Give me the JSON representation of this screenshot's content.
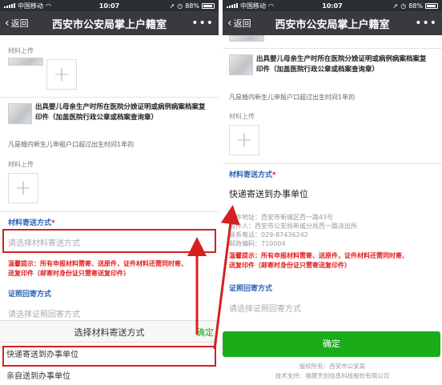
{
  "status": {
    "carrier": "中国移动",
    "time": "10:07",
    "battery": "88%"
  },
  "nav": {
    "back_label": "返回",
    "title": "西安市公安局掌上户籍室",
    "more": "•••"
  },
  "left": {
    "upload_label_1": "材料上传",
    "doc_title_line1": "出具婴儿母亲生产时所在医院分娩证明或病例病案档案复",
    "doc_title_line2": "印件（加盖医院行政公章或档案查询章）",
    "note": "凡是婚内新生儿申报户口超过出生时间1年的",
    "upload_label_2": "材料上传",
    "delivery_title": "材料寄送方式",
    "req_mark": "*",
    "delivery_placeholder": "请选择材料寄送方式",
    "warn_line1": "温馨提示：所有申报材料需寄、送原件，证件材料还需同时寄、",
    "warn_line2": "送复印件（邮寄时身份证只需寄送复印件）",
    "return_title": "证照回寄方式",
    "return_placeholder": "请选择证照回寄方式",
    "picker_title": "选择材料寄送方式",
    "picker_confirm": "确定",
    "option_1": "快递寄送到办事单位",
    "option_2": "亲自送到办事单位"
  },
  "right": {
    "doc_title_line1": "出具婴儿母亲生产时所在医院分娩证明或病例病案档案复",
    "doc_title_line2": "印件（加盖医院行政公章或档案查询章）",
    "note": "凡是婚内新生儿申报户口超过出生时间1年的",
    "upload_label": "材料上传",
    "delivery_title": "材料寄送方式",
    "req_mark": "*",
    "delivery_value": "快递寄送到办事单位",
    "addr_line1": "收件地址：西安市新城区西一路43号",
    "addr_line2": "收件人：西安市公安局新城分局西一路派出所",
    "addr_line3": "联系电话：029-87436242",
    "addr_line4": "邮政编码：710004",
    "warn_line1": "温馨提示：所有申报材料需寄、送原件，证件材料还需同时寄、",
    "warn_line2": "送复印件（邮寄时身份证只需寄送复印件）",
    "return_title": "证照回寄方式",
    "return_placeholder": "请选择证照回寄方式",
    "confirm_label": "确定",
    "footer_line1": "版权所有：西安市公安局",
    "footer_line2": "技术支持：福建天创信息科技股份有限公司"
  },
  "colors": {
    "accent_red": "#d42020",
    "brand_green": "#1aad19",
    "section_blue": "#2d64b3",
    "nav_bg": "#393a3f"
  }
}
